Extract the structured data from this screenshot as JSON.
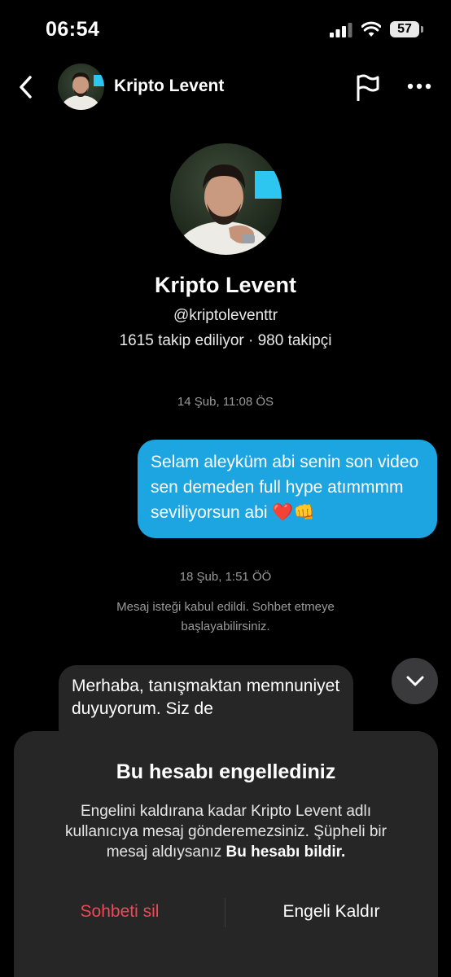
{
  "status_bar": {
    "time": "06:54",
    "battery": "57"
  },
  "header": {
    "name": "Kripto Levent"
  },
  "profile": {
    "name": "Kripto Levent",
    "handle": "@kriptoleventtr",
    "stats": "1615 takip ediliyor · 980 takipçi"
  },
  "messages": {
    "timestamp_1": "14 Şub, 11:08 ÖS",
    "outgoing_1": "Selam aleyküm abi senin son video sen demeden full  hype atımmmm seviliyorsun abi ❤️👊",
    "timestamp_2": "18 Şub, 1:51 ÖÖ",
    "system_1": "Mesaj isteği kabul edildi. Sohbet etmeye başlayabilirsiniz.",
    "incoming_1": "Merhaba, tanışmaktan memnuniyet duyuyorum. Siz de"
  },
  "sheet": {
    "title": "Bu hesabı engellediniz",
    "body": "Engelini kaldırana kadar Kripto Levent adlı kullanıcıya mesaj gönderemezsiniz. Şüpheli bir mesaj aldıysanız",
    "report_link": "Bu hesabı bildir.",
    "delete_label": "Sohbeti sil",
    "unblock_label": "Engeli Kaldır"
  },
  "colors": {
    "accent_blue": "#1da5e1",
    "danger_red": "#ed4956",
    "sheet_bg": "#262626"
  }
}
